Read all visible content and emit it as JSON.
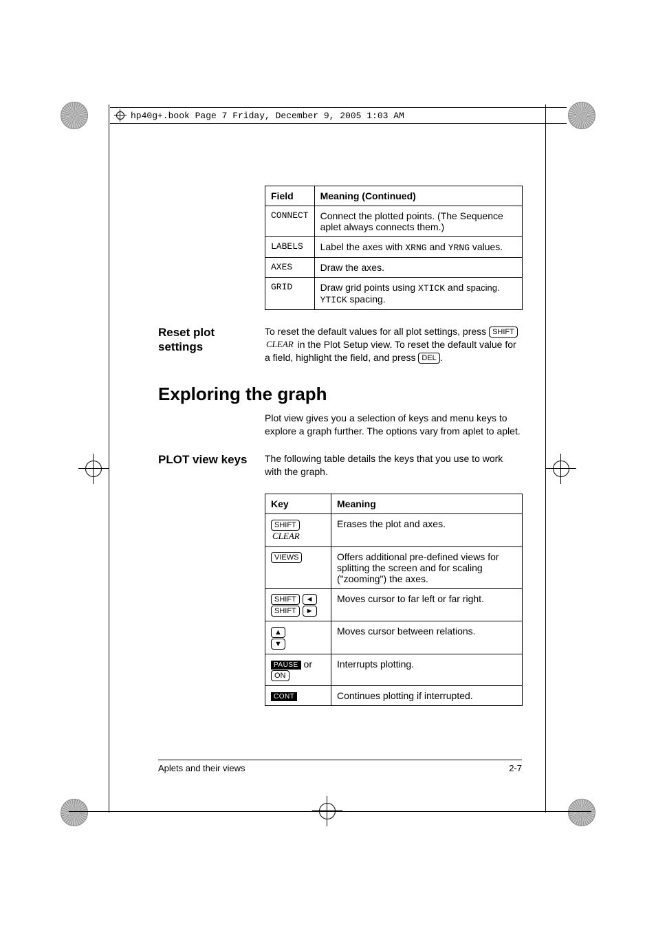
{
  "book_header": "hp40g+.book  Page 7  Friday, December 9, 2005  1:03 AM",
  "table1": {
    "head_field": "Field",
    "head_meaning": "Meaning  (Continued)",
    "rows": [
      {
        "field": "CONNECT",
        "meaning": "Connect the plotted points. (The Sequence aplet always connects them.)"
      },
      {
        "field": "LABELS",
        "meaning_pre": "Label the axes with ",
        "meaning_mono1": "XRNG",
        "meaning_mid": " and ",
        "meaning_mono2": "YRNG",
        "meaning_post": " values."
      },
      {
        "field": "AXES",
        "meaning": "Draw the axes."
      },
      {
        "field": "GRID",
        "meaning_pre": "Draw grid points using ",
        "meaning_mono1": "XTICK",
        "meaning_mid": " and ",
        "meaning_mono2": "YTICK",
        "meaning_post": " spacing."
      }
    ]
  },
  "reset": {
    "title": "Reset plot settings",
    "text_pre": "To reset the default values for all plot settings, press ",
    "shift": "SHIFT",
    "clear": "CLEAR",
    "text_mid": " in the Plot Setup view. To reset the default value for a field, highlight the field, and press ",
    "del": "DEL",
    "text_post": "."
  },
  "explore": {
    "title": "Exploring the graph",
    "para": "Plot view gives you a selection of keys and menu keys to explore a graph further. The options vary from aplet to aplet."
  },
  "plotkeys": {
    "title": "PLOT view keys",
    "intro": "The following table details the keys that you use to work with the graph.",
    "head_key": "Key",
    "head_meaning": "Meaning",
    "rows": {
      "r1": {
        "shift": "SHIFT",
        "clear": "CLEAR",
        "meaning": "Erases the plot and axes."
      },
      "r2": {
        "views": "VIEWS",
        "meaning": "Offers additional pre-defined views for splitting the screen and for scaling (\"zooming\") the axes."
      },
      "r3": {
        "shift": "SHIFT",
        "meaning": "Moves cursor to far left or far right."
      },
      "r4": {
        "meaning": "Moves cursor between relations."
      },
      "r5": {
        "pause": "PAUSE",
        "or": " or ",
        "on": "ON",
        "meaning": "Interrupts plotting."
      },
      "r6": {
        "cont": "CONT",
        "meaning": "Continues plotting if interrupted."
      }
    }
  },
  "footer": {
    "left": "Aplets and their views",
    "right": "2-7"
  }
}
